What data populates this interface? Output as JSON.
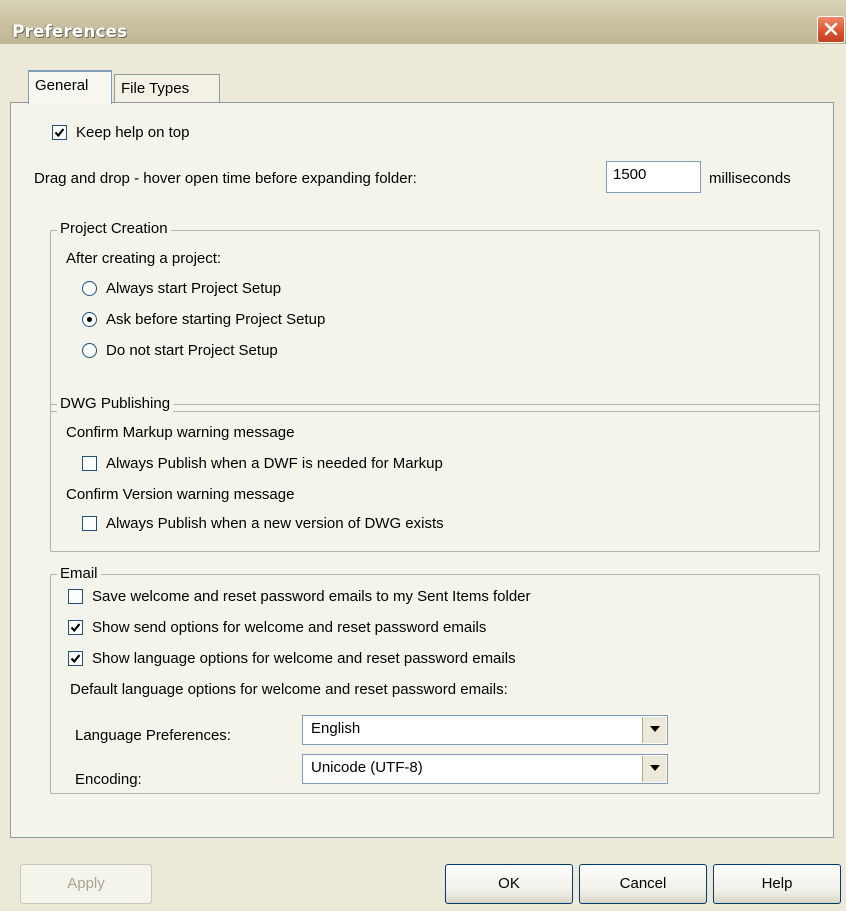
{
  "window": {
    "title": "Preferences",
    "close_icon": "close-icon"
  },
  "tabs": [
    {
      "label": "General",
      "active": true
    },
    {
      "label": "File Types",
      "active": false
    }
  ],
  "general": {
    "keep_help_on_top": {
      "label": "Keep help on top",
      "checked": true
    },
    "drag_drop": {
      "label": "Drag and drop - hover open time before expanding folder:",
      "value": "1500",
      "unit": "milliseconds"
    }
  },
  "project_creation": {
    "legend": "Project Creation",
    "prompt": "After creating a project:",
    "options": [
      {
        "label": "Always start Project Setup",
        "selected": false
      },
      {
        "label": "Ask before starting Project Setup",
        "selected": true
      },
      {
        "label": "Do not start Project Setup",
        "selected": false
      }
    ]
  },
  "dwg_publishing": {
    "legend": "DWG Publishing",
    "markup_heading": "Confirm Markup warning message",
    "markup_check": {
      "label": "Always Publish when a DWF is needed for Markup",
      "checked": false
    },
    "version_heading": "Confirm Version warning message",
    "version_check": {
      "label": "Always Publish when a new version of DWG exists",
      "checked": false
    }
  },
  "email": {
    "legend": "Email",
    "checks": [
      {
        "label": "Save welcome and reset password emails to my Sent Items folder",
        "checked": false
      },
      {
        "label": "Show send options for welcome and reset password emails",
        "checked": true
      },
      {
        "label": "Show language options for welcome and reset password emails",
        "checked": true
      }
    ],
    "default_heading": "Default language options for welcome and reset password emails:",
    "language": {
      "label": "Language Preferences:",
      "value": "English"
    },
    "encoding": {
      "label": "Encoding:",
      "value": "Unicode (UTF-8)"
    }
  },
  "buttons": {
    "apply": "Apply",
    "ok": "OK",
    "cancel": "Cancel",
    "help": "Help"
  }
}
